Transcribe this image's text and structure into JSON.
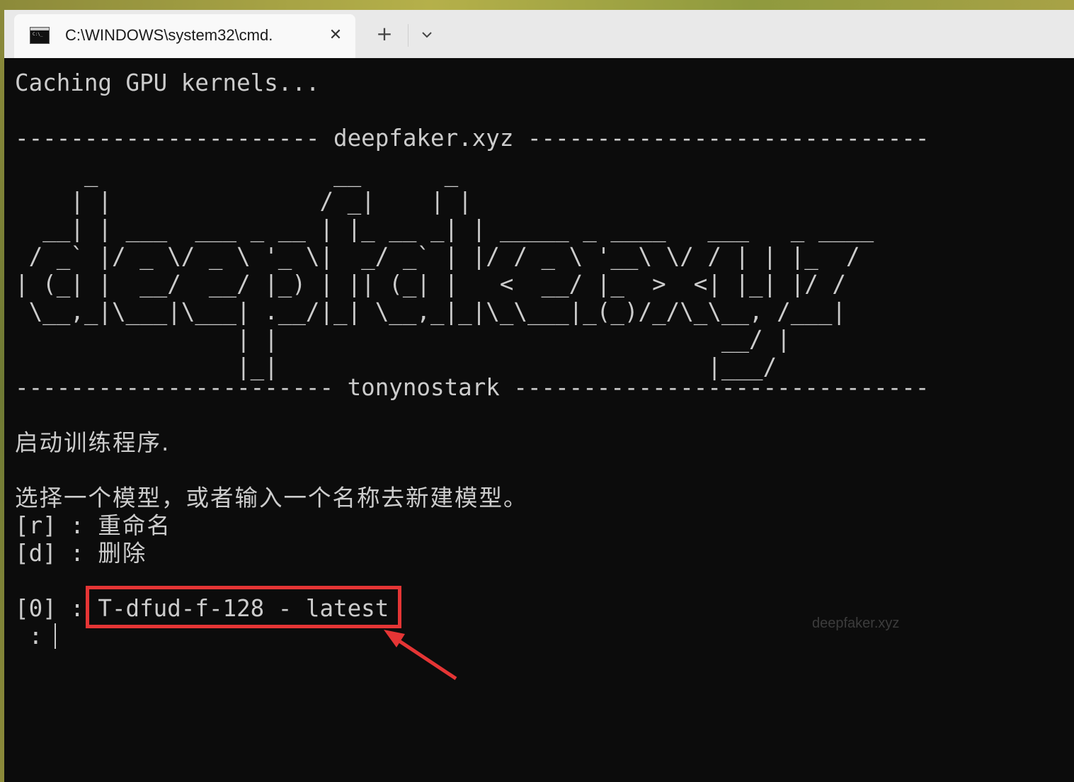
{
  "tab": {
    "title": "C:\\WINDOWS\\system32\\cmd.",
    "close_glyph": "✕",
    "new_tab_glyph": "+"
  },
  "console": {
    "line1": "Caching GPU kernels...",
    "divider_top": "---------------------- deepfaker.xyz -----------------------------",
    "ascii_art": "     _                 __      _\n    | |               / _|    | |\n  __| | ___  ___ _ __ | |_ __ _| | _____ _ ____   ___   _ ____\n / _` |/ _ \\/ _ \\ '_ \\|  _/ _` | |/ / _ \\ '__\\ \\/ / | | |_  /\n| (_| |  __/  __/ |_) | || (_| |   <  __/ |_  >  <| |_| |/ /\n \\__,_|\\___|\\___| .__/|_| \\__,_|_|\\_\\___|_(_)/_/\\_\\__, /___|\n                | |                                __/ |\n                |_|                               |___/",
    "divider_bottom": "----------------------- tonynostark ------------------------------",
    "start_msg": "启动训练程序.",
    "choose_msg": "选择一个模型，或者输入一个名称去新建模型。",
    "opt_r_key": "[r] : ",
    "opt_r_label": "重命名",
    "opt_d_key": "[d] : ",
    "opt_d_label": "删除",
    "model_key": "[0] : ",
    "model_value": "T-dfud-f-128 - latest",
    "prompt": " : "
  },
  "watermark": "deepfaker.xyz",
  "colors": {
    "console_bg": "#0c0c0c",
    "console_fg": "#cccccc",
    "highlight": "#e53535",
    "titlebar": "#e9e9e9"
  },
  "icons": [
    "cmd-icon",
    "close-icon",
    "plus-icon",
    "chevron-down-icon"
  ]
}
